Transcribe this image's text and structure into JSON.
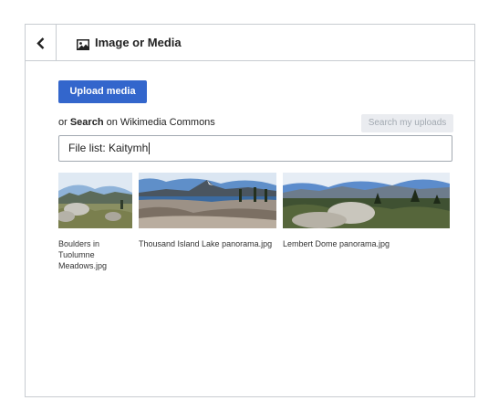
{
  "dialog": {
    "title": "Image or Media",
    "back_icon": "chevron-left-icon",
    "title_icon": "image-icon"
  },
  "upload": {
    "label": "Upload media"
  },
  "search": {
    "prefix": "or ",
    "bold": "Search",
    "suffix": " on Wikimedia Commons",
    "my_uploads_label": "Search my uploads",
    "value": "File list: Kaitymh"
  },
  "results": [
    {
      "caption": "Boulders in Tuolumne Meadows.jpg"
    },
    {
      "caption": "Thousand Island Lake panorama.jpg"
    },
    {
      "caption": "Lembert Dome panorama.jpg"
    }
  ],
  "colors": {
    "accent": "#3366cc",
    "border": "#c8ccd1",
    "disabled_bg": "#eaecf0",
    "disabled_text": "#a2a9b1"
  }
}
